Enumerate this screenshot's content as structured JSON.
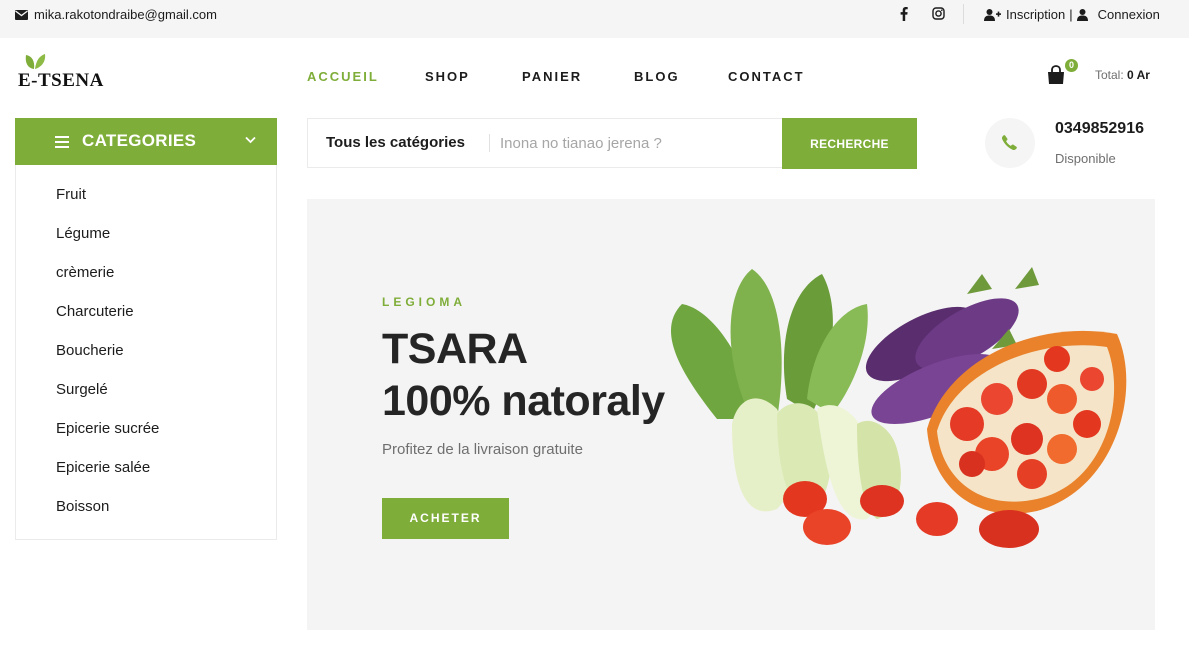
{
  "topbar": {
    "email": "mika.rakotondraibe@gmail.com",
    "social": [
      {
        "icon": "facebook-icon",
        "glyph": "f"
      },
      {
        "icon": "instagram-icon"
      }
    ],
    "register_label": "Inscription",
    "separator": "|",
    "login_label": "Connexion"
  },
  "header": {
    "logo_text": "E-TSENA",
    "nav": [
      {
        "label": "ACCUEIL",
        "active": true
      },
      {
        "label": "SHOP",
        "active": false
      },
      {
        "label": "PANIER",
        "active": false
      },
      {
        "label": "BLOG",
        "active": false
      },
      {
        "label": "CONTACT",
        "active": false
      }
    ],
    "cart_count": "0",
    "total_label": "Total:",
    "total_value": "0 Ar"
  },
  "categories": {
    "title": "CATEGORIES",
    "items": [
      "Fruit",
      "Légume",
      "crèmerie",
      "Charcuterie",
      "Boucherie",
      "Surgelé",
      "Epicerie sucrée",
      "Epicerie salée",
      "Boisson"
    ]
  },
  "search": {
    "category_label": "Tous les catégories",
    "placeholder": "Inona no tianao jerena ?",
    "button_label": "RECHERCHE"
  },
  "contact": {
    "phone": "0349852916",
    "status": "Disponible"
  },
  "hero": {
    "eyebrow": "LEGIOMA",
    "title_line1": "TSARA",
    "title_line2": "100% natoraly",
    "subtitle": "Profitez de la livraison gratuite",
    "cta_label": "ACHETER"
  },
  "colors": {
    "accent": "#7fad39",
    "text": "#1c1c1c",
    "muted": "#6f6f6f",
    "topbar_bg": "#f5f5f5",
    "hero_bg": "#f4f4f4"
  }
}
